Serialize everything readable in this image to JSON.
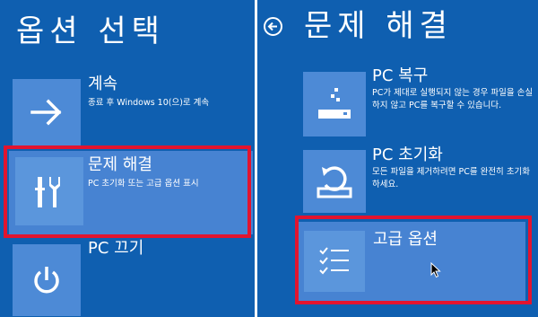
{
  "left_screen": {
    "title": "옵션 선택",
    "options": [
      {
        "id": "continue",
        "icon": "right-arrow-icon",
        "label": "계속",
        "description": "종료 후 Windows 10(으)로 계속"
      },
      {
        "id": "troubleshoot",
        "icon": "tools-icon",
        "label": "문제 해결",
        "description": "PC 초기화 또는 고급 옵션 표시",
        "selected": true
      },
      {
        "id": "turn-off",
        "icon": "power-icon",
        "label": "PC 끄기",
        "description": ""
      }
    ]
  },
  "right_screen": {
    "back_icon": "back-arrow-icon",
    "title": "문제 해결",
    "options": [
      {
        "id": "pc-restore",
        "icon": "restore-icon",
        "label": "PC 복구",
        "description": "PC가 제대로 실행되지 않는 경우 파일을 손실하지 않고 PC를 복구할 수 있습니다."
      },
      {
        "id": "pc-reset",
        "icon": "reset-icon",
        "label": "PC 초기화",
        "description": "모든 파일을 제거하려면 PC를 완전히 초기화하세요."
      },
      {
        "id": "advanced",
        "icon": "checklist-icon",
        "label": "고급 옵션",
        "description": "",
        "selected": true
      }
    ]
  },
  "colors": {
    "background": "#0f5fb0",
    "tile_icon": "#4d8ad6",
    "selected_tile": "#4783d2",
    "highlight": "#e2142f",
    "text": "#ffffff"
  }
}
